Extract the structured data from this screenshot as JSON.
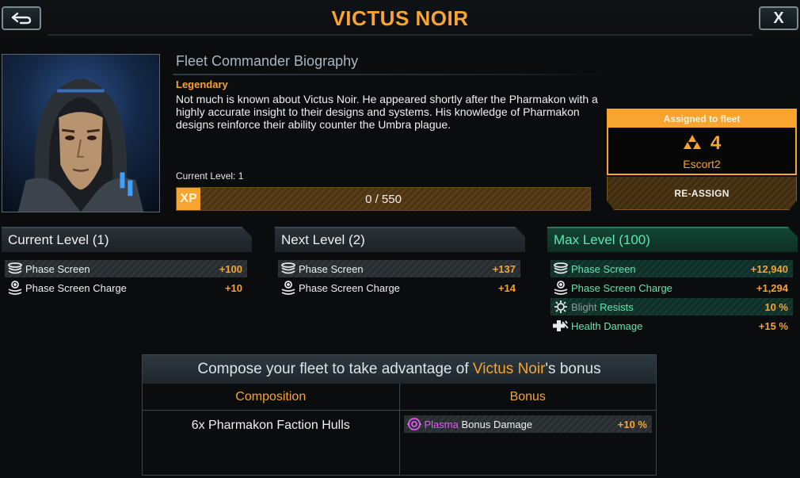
{
  "header": {
    "title": "VICTUS NOIR",
    "back_icon": "back-arrow-icon",
    "close_label": "X"
  },
  "bio": {
    "heading": "Fleet Commander Biography",
    "rarity": "Legendary",
    "text": "Not much is known about Victus Noir. He appeared shortly after the Pharmakon with a highly accurate insight to their designs and systems. His knowledge of Pharmakon designs reinforce their ability counter the Umbra plague.",
    "current_level_label": "Current Level: 1",
    "xp_tag": "XP",
    "xp_text": "0 / 550",
    "xp_progress": 0
  },
  "fleet": {
    "header": "Assigned to fleet",
    "number": "4",
    "name": "Escort2",
    "reassign_label": "RE-ASSIGN"
  },
  "levels": {
    "current": {
      "title": "Current Level (1)",
      "stats": [
        {
          "icon": "phase-screen-icon",
          "name": "Phase Screen",
          "value": "+100"
        },
        {
          "icon": "phase-screen-charge-icon",
          "name": "Phase Screen Charge",
          "value": "+10"
        }
      ]
    },
    "next": {
      "title": "Next Level (2)",
      "stats": [
        {
          "icon": "phase-screen-icon",
          "name": "Phase Screen",
          "value": "+137"
        },
        {
          "icon": "phase-screen-charge-icon",
          "name": "Phase Screen Charge",
          "value": "+14"
        }
      ]
    },
    "max": {
      "title": "Max Level (100)",
      "stats": [
        {
          "icon": "phase-screen-icon",
          "name": "Phase Screen",
          "value": "+12,940"
        },
        {
          "icon": "phase-screen-charge-icon",
          "name": "Phase Screen Charge",
          "value": "+1,294"
        },
        {
          "icon": "blight-icon",
          "name_part1": "Blight",
          "name_part2": "Resists",
          "value": "10 %"
        },
        {
          "icon": "health-damage-icon",
          "name": "Health Damage",
          "value": "+15 %"
        }
      ]
    }
  },
  "bonus": {
    "heading_pre": "Compose your fleet to take advantage of ",
    "heading_name": "Victus Noir",
    "heading_post": "'s bonus",
    "col_composition": "Composition",
    "col_bonus": "Bonus",
    "composition": "6x Pharmakon Faction Hulls",
    "bonus_type": "Plasma",
    "bonus_name": "Bonus Damage",
    "bonus_value": "+10 %",
    "bonus_icon": "plasma-icon"
  },
  "colors": {
    "accent": "#f7a430",
    "max_level": "#5ce6b4",
    "plasma": "#e05cf0"
  }
}
